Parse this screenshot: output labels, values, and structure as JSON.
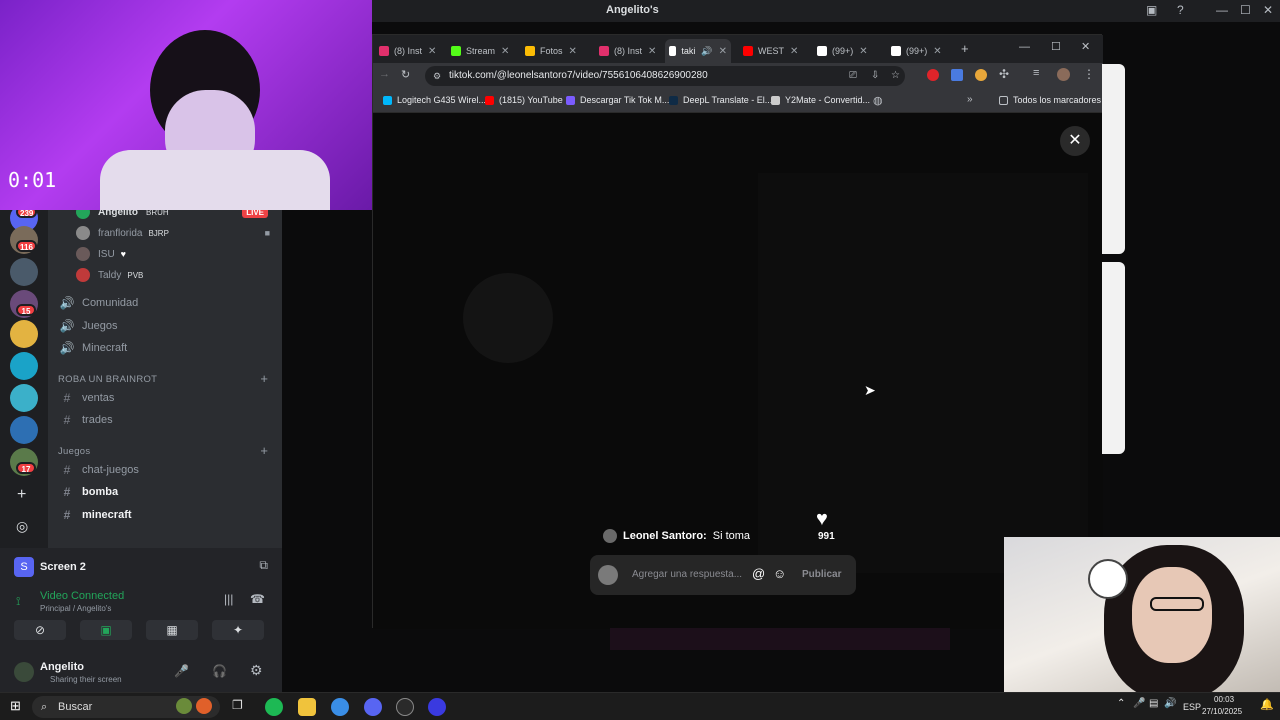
{
  "window": {
    "title": "Angelito's",
    "controls": [
      "—",
      "☐",
      "✕"
    ]
  },
  "rail": {
    "badges": [
      "239",
      "116",
      "15",
      "17"
    ]
  },
  "channels": {
    "voice_users": [
      {
        "name": "Angelito",
        "tag": "BRUH",
        "status": "LIVE"
      },
      {
        "name": "franflorida",
        "tag": "BJRP"
      },
      {
        "name": "ISU",
        "tag": "♥"
      },
      {
        "name": "Taldy",
        "tag": "PVB"
      }
    ],
    "voice_channels": [
      "Comunidad",
      "Juegos",
      "Minecraft"
    ],
    "categories": [
      {
        "label": "ROBA UN BRAINROT",
        "channels": [
          "ventas",
          "trades"
        ]
      },
      {
        "label": "Juegos",
        "channels": [
          "chat-juegos",
          "bomba",
          "minecraft"
        ]
      }
    ]
  },
  "voice_panel": {
    "screen_title": "Screen 2",
    "status": "Video Connected",
    "location": "Principal / Angelito's",
    "user_name": "Angelito",
    "user_status": "Sharing their screen"
  },
  "chrome": {
    "tabs": [
      {
        "label": "(8) Inst",
        "color": "#e1306c"
      },
      {
        "label": "Stream",
        "color": "#53fc18"
      },
      {
        "label": "Fotos",
        "color": "#fbbc05"
      },
      {
        "label": "(8) Inst",
        "color": "#e1306c"
      },
      {
        "label": "taki",
        "color": "#ffffff",
        "active": true
      },
      {
        "label": "WEST",
        "color": "#ff0000"
      },
      {
        "label": "(99+)",
        "color": "#ffffff"
      },
      {
        "label": "(99+)",
        "color": "#ffffff"
      }
    ],
    "url": "tiktok.com/@leonelsantoro7/video/7556106408626900280",
    "bookmarks": [
      {
        "label": "Logitech G435 Wirel...",
        "color": "#00b8fc"
      },
      {
        "label": "(1815) YouTube",
        "color": "#ff0000"
      },
      {
        "label": "Descargar Tik Tok M...",
        "color": "#7b5cff"
      },
      {
        "label": "DeepL Translate - El...",
        "color": "#0f2b46"
      },
      {
        "label": "Y2Mate - Convertid...",
        "color": "#cccccc"
      }
    ],
    "all_bookmarks": "Todos los marcadores"
  },
  "tiktok": {
    "comment_author": "Leonel Santoro:",
    "comment_text": "Si toma",
    "like_count": "991",
    "reply_placeholder": "Agregar una respuesta...",
    "publish_label": "Publicar"
  },
  "taskbar": {
    "search_placeholder": "Buscar",
    "language": "ESP",
    "time": "00:03",
    "date": "27/10/2025"
  },
  "colors": {
    "discord_bg": "#1e1f22",
    "channel_bg": "#2b2d31",
    "live_red": "#ed4245",
    "connected_green": "#23a55a"
  }
}
